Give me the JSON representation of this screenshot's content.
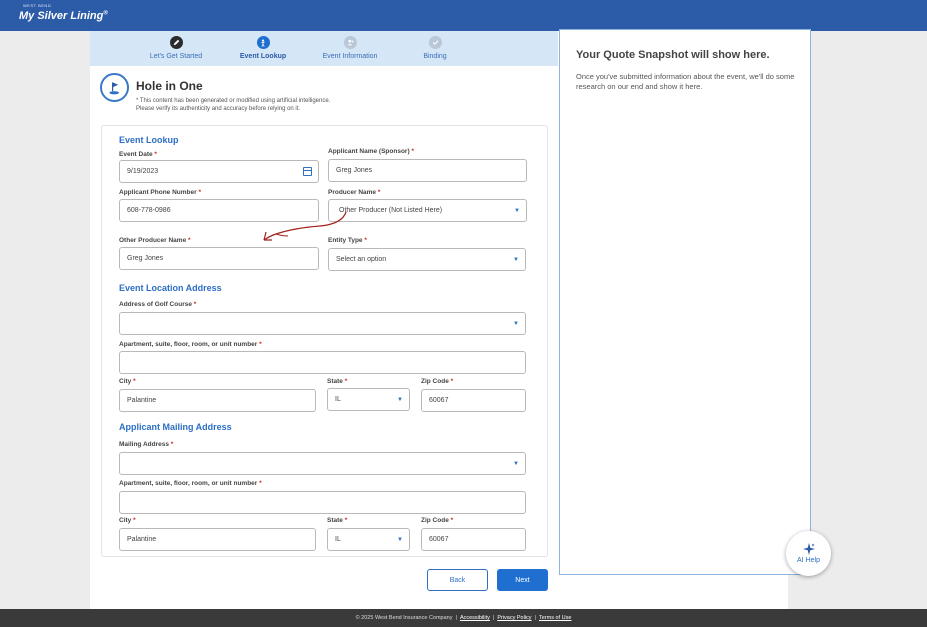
{
  "header": {
    "brand_small": "WEST BEND",
    "brand_name": "My Silver Lining",
    "brand_mark": "®",
    "bg_color": "#2c5ba8"
  },
  "steps": [
    {
      "label": "Let's Get Started",
      "icon": "pencil-icon",
      "state": "complete"
    },
    {
      "label": "Event Lookup",
      "icon": "golfer-icon",
      "state": "active"
    },
    {
      "label": "Event Information",
      "icon": "person-add-icon",
      "state": "pending"
    },
    {
      "label": "Binding",
      "icon": "check-icon",
      "state": "pending"
    }
  ],
  "page": {
    "title": "Hole in One",
    "ai_note_line1": "* This content has been generated or modified using artificial intelligence.",
    "ai_note_line2": "Please verify its authenticity and accuracy before relying on it."
  },
  "event_lookup": {
    "section_title": "Event Lookup",
    "event_date_label": "Event Date",
    "event_date_value": "9/19/2023",
    "applicant_name_label": "Applicant Name (Sponsor)",
    "applicant_name_value": "Greg Jones",
    "phone_label": "Applicant Phone Number",
    "phone_value": "608-778-0986",
    "producer_label": "Producer Name",
    "producer_value": "Other Producer (Not Listed Here)",
    "other_producer_label": "Other Producer Name",
    "other_producer_value": "Greg Jones",
    "entity_label": "Entity Type",
    "entity_placeholder": "Select an option"
  },
  "event_location": {
    "section_title": "Event Location Address",
    "address_label": "Address of Golf Course",
    "address_value": "",
    "apt_label": "Apartment, suite, floor, room, or unit number",
    "apt_value": "",
    "city_label": "City",
    "city_value": "Palantine",
    "state_label": "State",
    "state_value": "IL",
    "zip_label": "Zip Code",
    "zip_value": "60067"
  },
  "mailing": {
    "section_title": "Applicant Mailing Address",
    "address_label": "Mailing Address",
    "address_value": "",
    "apt_label": "Apartment, suite, floor, room, or unit number",
    "apt_value": "",
    "city_label": "City",
    "city_value": "Palantine",
    "state_label": "State",
    "state_value": "IL",
    "zip_label": "Zip Code",
    "zip_value": "60067"
  },
  "buttons": {
    "back": "Back",
    "next": "Next"
  },
  "quote": {
    "title": "Your Quote Snapshot will show here.",
    "body": "Once you've submitted information about the event, we'll do some research on our end and show it here."
  },
  "ai_help": {
    "label": "AI Help",
    "icon": "sparkle-icon"
  },
  "footer": {
    "copyright": "© 2025 West Bend Insurance Company",
    "accessibility": "Accessibility",
    "privacy": "Privacy Policy",
    "terms": "Terms of Use"
  },
  "required_mark": "*",
  "colors": {
    "accent": "#2c6fc4",
    "required": "#c62828",
    "annotation": "#a3221b",
    "step_complete": "#2b2b2b",
    "step_active": "#1f6fd1",
    "step_pending": "#b9c7d6"
  }
}
